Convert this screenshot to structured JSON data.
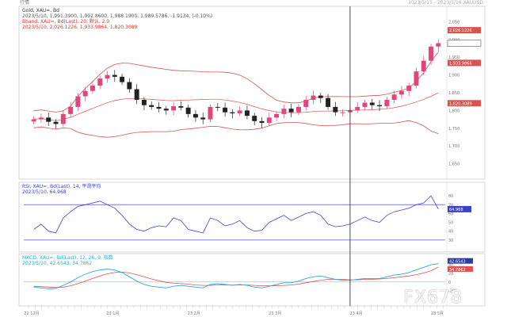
{
  "window": {
    "top_left": "行情",
    "top_right": "2023/5/15 - 2023/5/16 XAUUSD"
  },
  "panels": {
    "price": {
      "line1": "Gold, XAU=, Bd",
      "line2": "2023/5/10, 1,991.3900, 1,992.8600, 1,988.1900, 1,989.5786, -1.9134, (-0.10%)",
      "line3": "Bband, XAU=, Bd(Last), 20, 默认, 2.0",
      "line4": "2023/5/10, 2,026.1226, 1,933.9864, 1,820.3089"
    },
    "rsi": {
      "line1": "RSI, XAU=, Bd(Last), 14, 平滑平均",
      "line2": "2023/5/10, 64.968"
    },
    "macd": {
      "line1": "MACD, XAU=, Bd(Last), 12, 26, 9, 指数",
      "line2": "2023/5/10, 42.6543, 34.7862"
    }
  },
  "watermark": "FX678",
  "colors": {
    "bull_candle": "#e0457b",
    "bear_candle": "#222222",
    "bollinger": "#d9534f",
    "rsi_line": "#3a43c8",
    "macd_line": "#29a8e0",
    "signal_line": "#e05050",
    "cursor": "#222222"
  },
  "chart_data": [
    {
      "type": "candlestick",
      "title": "Gold, XAU=, Bd",
      "series": [
        {
          "name": "Gold, XAU=, Bd",
          "values": [
            1775,
            1780,
            1768,
            1762,
            1790,
            1810,
            1840,
            1855,
            1870,
            1890,
            1900,
            1895,
            1880,
            1860,
            1830,
            1815,
            1810,
            1805,
            1800,
            1812,
            1808,
            1790,
            1780,
            1775,
            1810,
            1808,
            1795,
            1792,
            1800,
            1785,
            1770,
            1765,
            1780,
            1790,
            1805,
            1795,
            1810,
            1830,
            1842,
            1835,
            1810,
            1795,
            1795,
            1800,
            1810,
            1822,
            1815,
            1812,
            1830,
            1845,
            1855,
            1870,
            1910,
            1940,
            1980,
            1989.58
          ]
        },
        {
          "name": "Bband upper"
        },
        {
          "name": "Bband middle"
        },
        {
          "name": "Bband lower"
        }
      ],
      "markers": [
        "2,026.1226",
        "1,989.5786",
        "1,933.9864",
        "1,820.3089"
      ],
      "yaxis_labels": [
        "2,050",
        "2,000",
        "1,950",
        "1,900",
        "1,850",
        "1,800",
        "1,750",
        "1,700",
        "1,650"
      ],
      "ylim": [
        1620,
        2080
      ]
    },
    {
      "type": "line",
      "title": "RSI, XAU=, Bd(Last), 14",
      "series": [
        {
          "name": "RSI",
          "values": [
            42,
            48,
            40,
            38,
            55,
            62,
            68,
            70,
            72,
            74,
            70,
            66,
            58,
            48,
            42,
            40,
            44,
            46,
            45,
            55,
            52,
            42,
            40,
            38,
            55,
            52,
            46,
            48,
            52,
            44,
            40,
            41,
            50,
            54,
            58,
            52,
            56,
            60,
            62,
            58,
            48,
            45,
            46,
            48,
            52,
            56,
            52,
            50,
            58,
            62,
            64,
            66,
            70,
            72,
            80,
            64.97
          ]
        }
      ],
      "reference_lines": [
        70,
        30
      ],
      "marker": "64.968",
      "yaxis_labels": [
        "80",
        "70",
        "60",
        "50",
        "40",
        "30"
      ],
      "ylim": [
        20,
        90
      ]
    },
    {
      "type": "line",
      "title": "MACD, XAU=, Bd(Last), 12, 26, 9",
      "series": [
        {
          "name": "MACD",
          "values": [
            -12,
            -14,
            -16,
            -15,
            -8,
            0,
            10,
            18,
            24,
            28,
            30,
            28,
            22,
            12,
            2,
            -6,
            -10,
            -12,
            -14,
            -10,
            -8,
            -10,
            -12,
            -14,
            -6,
            -4,
            -6,
            -8,
            -6,
            -8,
            -12,
            -14,
            -10,
            -6,
            -2,
            -2,
            2,
            8,
            12,
            14,
            10,
            6,
            4,
            4,
            6,
            8,
            8,
            8,
            12,
            16,
            18,
            22,
            28,
            34,
            40,
            42.65
          ]
        },
        {
          "name": "Signal",
          "values": [
            -10,
            -11,
            -12,
            -13,
            -12,
            -9,
            -4,
            2,
            8,
            14,
            19,
            22,
            23,
            21,
            17,
            12,
            7,
            3,
            -1,
            -3,
            -4,
            -5,
            -7,
            -8,
            -8,
            -7,
            -7,
            -7,
            -7,
            -7,
            -8,
            -9,
            -9,
            -9,
            -8,
            -7,
            -5,
            -2,
            1,
            4,
            6,
            6,
            6,
            5,
            5,
            6,
            6,
            7,
            8,
            10,
            12,
            14,
            17,
            21,
            26,
            34.79
          ]
        }
      ],
      "markers": [
        "42.6543",
        "34.7862"
      ],
      "yaxis_labels": [
        "40",
        "20",
        "0",
        "-20"
      ],
      "ylim": [
        -30,
        55
      ]
    }
  ],
  "xaxis": {
    "labels": [
      "22 12月",
      "23 1月",
      "23 2月",
      "23 3月",
      "23 4月",
      "23 5月"
    ]
  }
}
